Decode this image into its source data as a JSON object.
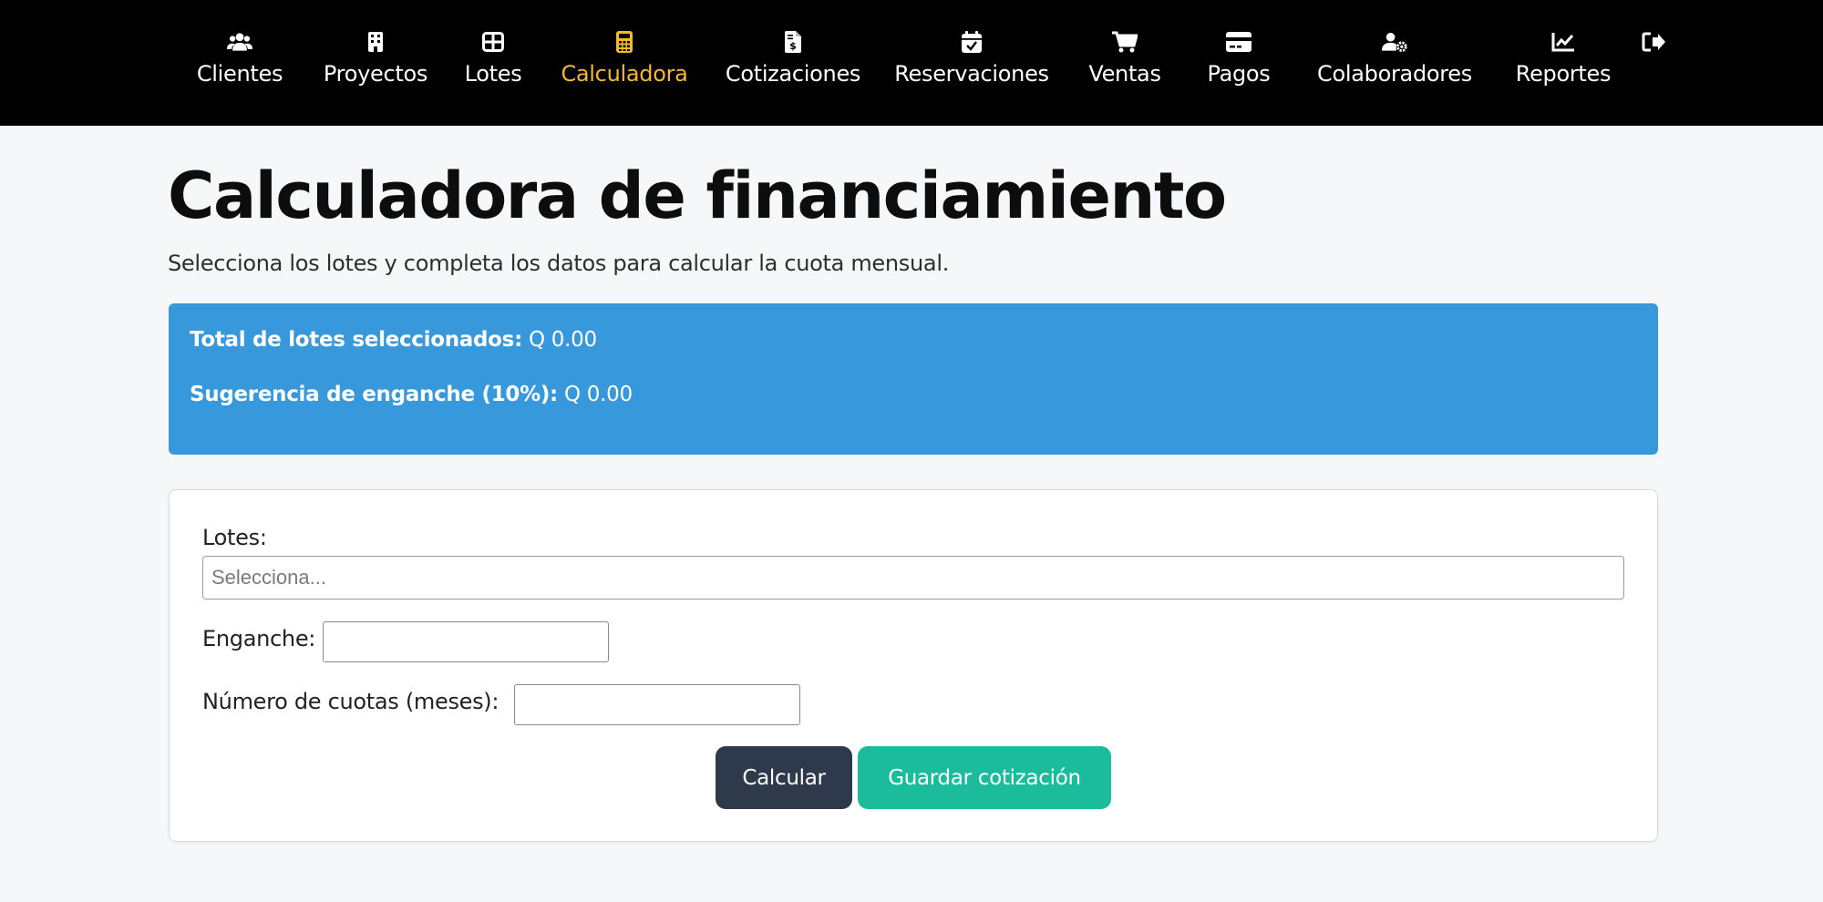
{
  "nav": {
    "items": [
      {
        "label": "Clientes",
        "icon": "users-icon"
      },
      {
        "label": "Proyectos",
        "icon": "building-icon"
      },
      {
        "label": "Lotes",
        "icon": "grid-icon"
      },
      {
        "label": "Calculadora",
        "icon": "calculator-icon",
        "active": true
      },
      {
        "label": "Cotizaciones",
        "icon": "invoice-dollar-icon"
      },
      {
        "label": "Reservaciones",
        "icon": "calendar-check-icon"
      },
      {
        "label": "Ventas",
        "icon": "cart-icon"
      },
      {
        "label": "Pagos",
        "icon": "credit-card-icon"
      },
      {
        "label": "Colaboradores",
        "icon": "user-gear-icon"
      },
      {
        "label": "Reportes",
        "icon": "line-chart-icon"
      }
    ],
    "logout_icon": "logout-icon",
    "active_color": "#f5b82e"
  },
  "main": {
    "title": "Calculadora de financiamiento",
    "subtitle": "Selecciona los lotes y completa los datos para calcular la cuota mensual."
  },
  "summary": {
    "total_label": "Total de lotes seleccionados:",
    "total_value": "Q 0.00",
    "down_label": "Sugerencia de enganche (10%):",
    "down_value": "Q 0.00",
    "background": "#3898dc"
  },
  "form": {
    "lotes_label": "Lotes:",
    "lotes_placeholder": "Selecciona...",
    "enganche_label": "Enganche:",
    "enganche_value": "",
    "cuotas_label": "Número de cuotas (meses):",
    "cuotas_value": "",
    "calc_button": "Calcular",
    "save_button": "Guardar cotización",
    "calc_color": "#2e3a4c",
    "save_color": "#1bbc9b"
  }
}
